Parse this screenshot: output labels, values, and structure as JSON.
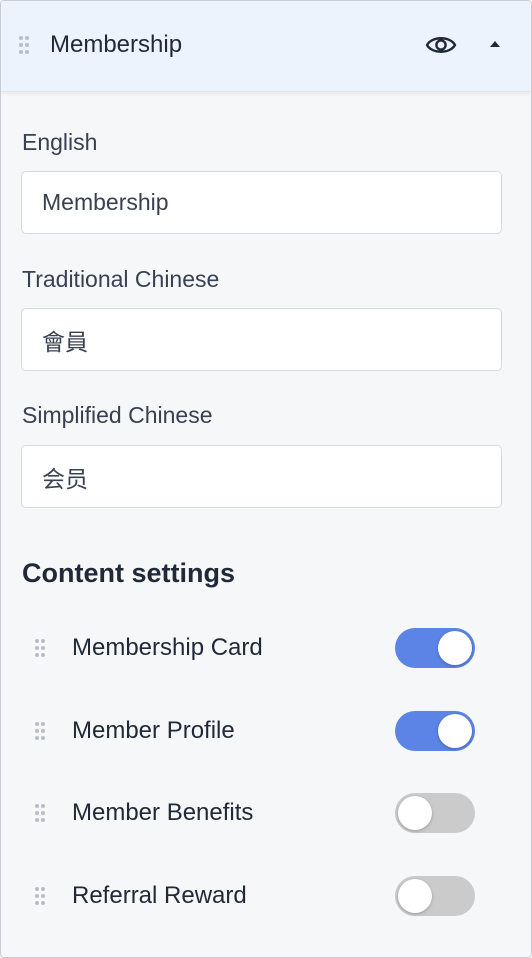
{
  "header": {
    "title": "Membership",
    "icons": {
      "drag": "drag-handle-icon",
      "visibility": "eye-icon",
      "collapse": "caret-up-icon"
    }
  },
  "fields": [
    {
      "label": "English",
      "value": "Membership"
    },
    {
      "label": "Traditional Chinese",
      "value": "會員"
    },
    {
      "label": "Simplified Chinese",
      "value": "会员"
    }
  ],
  "content_settings": {
    "title": "Content settings",
    "items": [
      {
        "label": "Membership Card",
        "enabled": true
      },
      {
        "label": "Member Profile",
        "enabled": true
      },
      {
        "label": "Member Benefits",
        "enabled": false
      },
      {
        "label": "Referral Reward",
        "enabled": false
      }
    ]
  },
  "colors": {
    "toggle_on": "#5b84e6",
    "toggle_off": "#cbcbcb",
    "header_bg": "#edf3fd",
    "panel_bg": "#f6f7f9"
  }
}
